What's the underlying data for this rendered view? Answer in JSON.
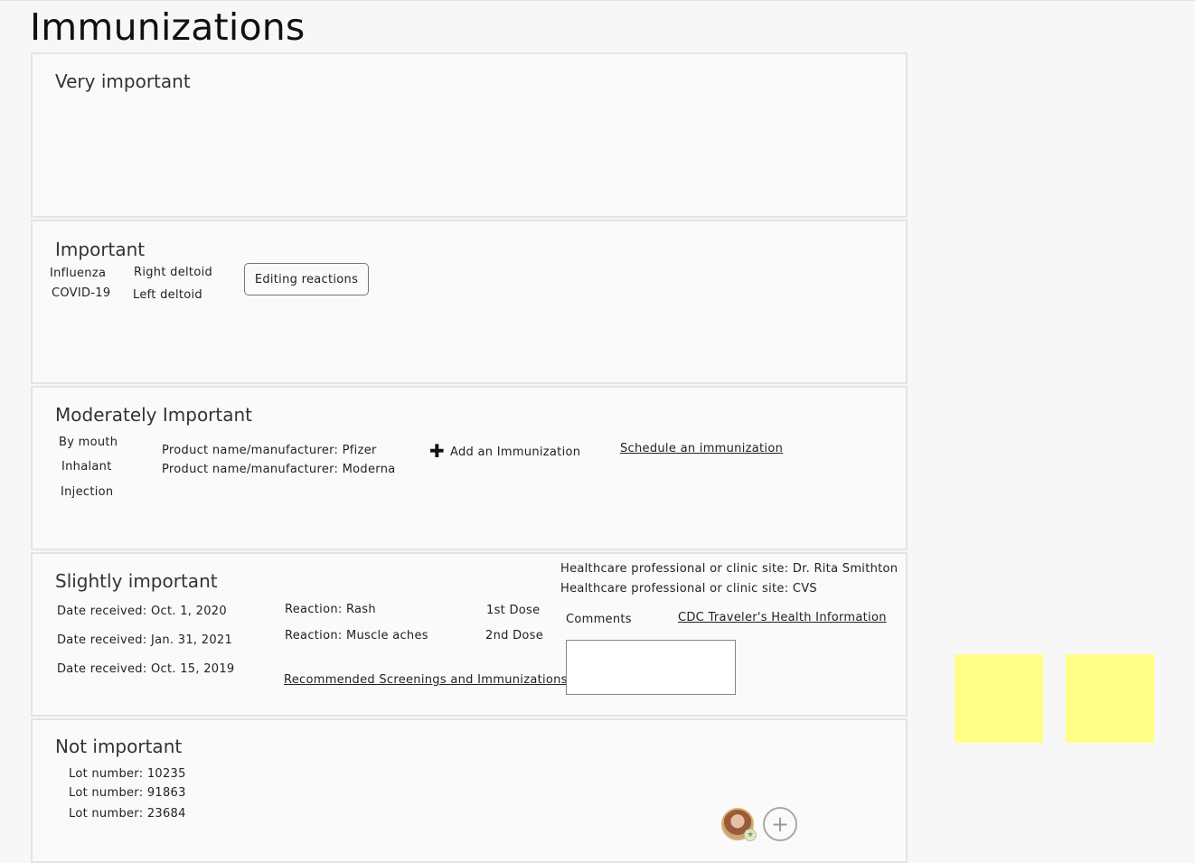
{
  "page_title": "Immunizations",
  "colors": {
    "sticky_note": "#ffff88",
    "section_border": "#e4e4e4"
  },
  "sections": {
    "very_important": {
      "title": "Very important"
    },
    "important": {
      "title": "Important",
      "vaccines": [
        "Influenza",
        "COVID-19"
      ],
      "sites": [
        "Right deltoid",
        "Left deltoid"
      ],
      "editing_button": "Editing reactions"
    },
    "moderately_important": {
      "title": "Moderately Important",
      "routes": [
        "By mouth",
        "Inhalant",
        "Injection"
      ],
      "products": [
        "Product name/manufacturer: Pfizer",
        "Product name/manufacturer: Moderna"
      ],
      "add_label": "Add an Immunization",
      "add_icon": "plus-icon",
      "schedule_link": "Schedule an immunization"
    },
    "slightly_important": {
      "title": "Slightly important",
      "dates": [
        "Date received: Oct. 1, 2020",
        "Date received: Jan. 31, 2021",
        "Date received: Oct. 15, 2019"
      ],
      "reactions": [
        "Reaction: Rash",
        "Reaction: Muscle aches"
      ],
      "doses": [
        "1st Dose",
        "2nd Dose"
      ],
      "recommended_link": "Recommended Screenings and Immunizations",
      "providers": [
        "Healthcare professional or clinic site: Dr. Rita Smithton",
        "Healthcare professional or clinic site: CVS"
      ],
      "comments_label": "Comments",
      "comments_value": "",
      "cdc_link": "CDC Traveler's Health Information"
    },
    "not_important": {
      "title": "Not important",
      "lots": [
        "Lot number: 10235",
        "Lot number: 91863",
        "Lot number: 23684"
      ]
    }
  },
  "collab": {
    "avatar_icon": "user-avatar",
    "badge_icon": "star-badge-icon",
    "add_icon": "plus-circle-icon",
    "add_symbol": "+"
  }
}
